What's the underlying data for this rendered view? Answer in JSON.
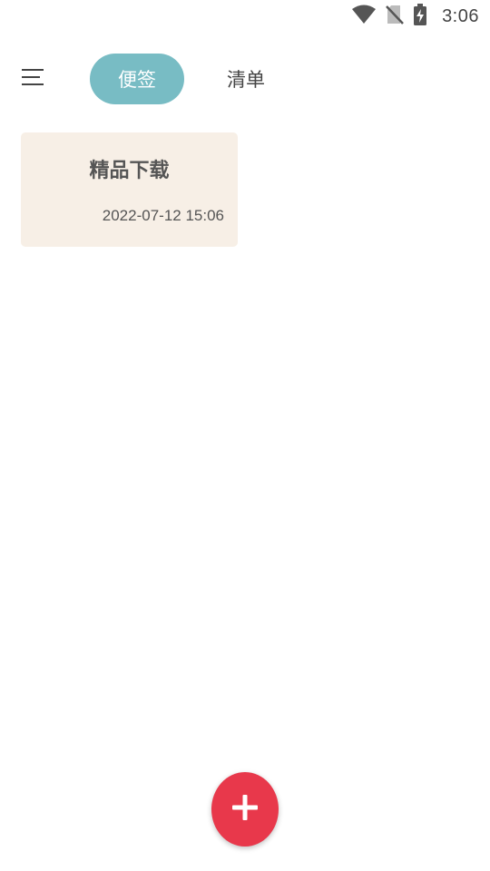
{
  "status_bar": {
    "time": "3:06",
    "icons": [
      "wifi-icon",
      "no-sim-icon",
      "battery-charging-icon"
    ]
  },
  "header": {
    "menu_icon": "hamburger-menu-icon",
    "tabs": [
      {
        "label": "便签",
        "active": true
      },
      {
        "label": "清单",
        "active": false
      }
    ],
    "accent_color": "#78bcc4"
  },
  "notes": [
    {
      "title": "精品下载",
      "date": "2022-07-12 15:06",
      "background": "#f7efe6"
    }
  ],
  "fab": {
    "icon": "plus-icon",
    "color": "#e8384b"
  }
}
